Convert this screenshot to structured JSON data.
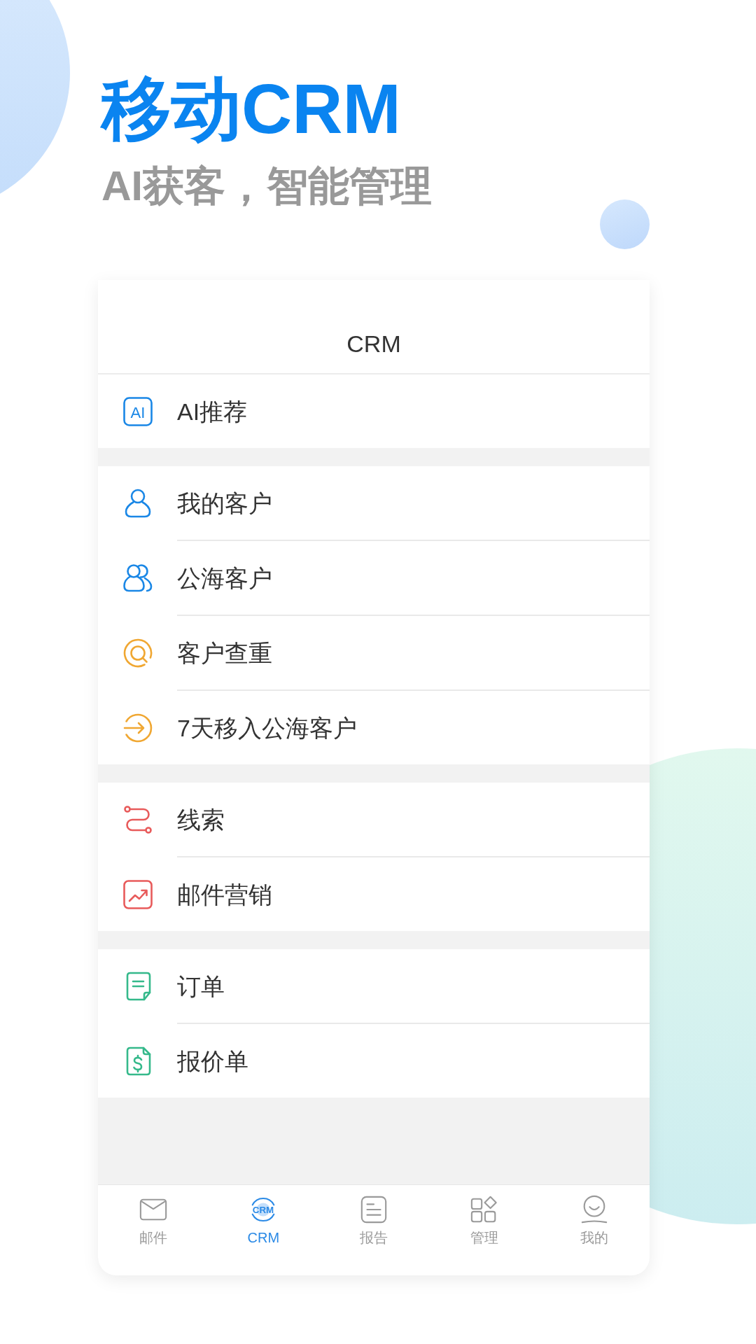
{
  "headline": "移动CRM",
  "tagline": "AI获客，智能管理",
  "screen": {
    "title": "CRM",
    "sections": [
      {
        "items": [
          {
            "label": "AI推荐",
            "color": "#1a87e6",
            "icon_text": "AI"
          }
        ]
      },
      {
        "items": [
          {
            "label": "我的客户",
            "color": "#1a87e6"
          },
          {
            "label": "公海客户",
            "color": "#1a87e6"
          },
          {
            "label": "客户查重",
            "color": "#f0a732"
          },
          {
            "label": "7天移入公海客户",
            "color": "#f0a732"
          }
        ]
      },
      {
        "items": [
          {
            "label": "线索",
            "color": "#e85b5b"
          },
          {
            "label": "邮件营销",
            "color": "#e85b5b"
          }
        ]
      },
      {
        "items": [
          {
            "label": "订单",
            "color": "#35b98b"
          },
          {
            "label": "报价单",
            "color": "#35b98b"
          }
        ]
      }
    ]
  },
  "tab_bar": [
    {
      "label": "邮件",
      "selected": false
    },
    {
      "label": "CRM",
      "selected": true,
      "icon_text": "CRM"
    },
    {
      "label": "报告",
      "selected": false
    },
    {
      "label": "管理",
      "selected": false
    },
    {
      "label": "我的",
      "selected": false
    }
  ]
}
